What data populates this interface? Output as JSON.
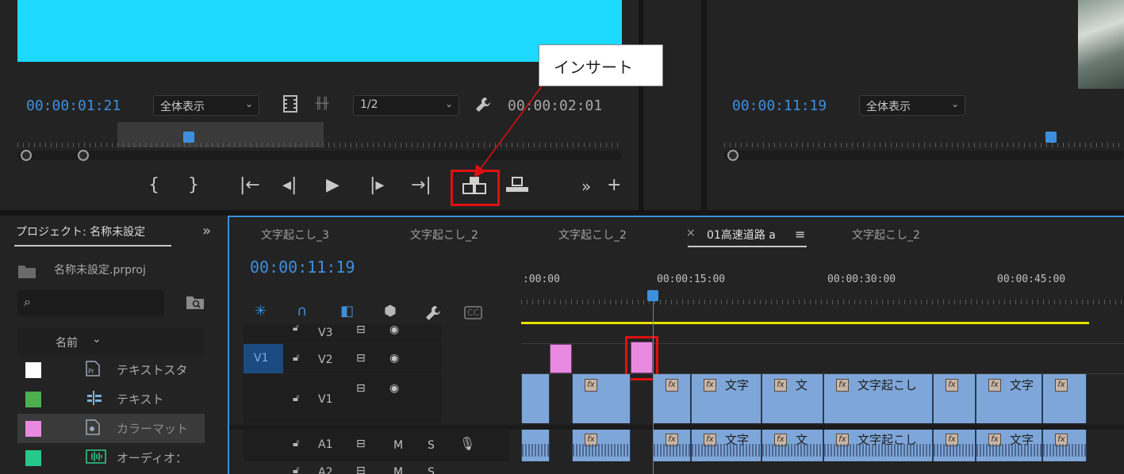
{
  "source_monitor": {
    "current_timecode": "00:00:01:21",
    "zoom_select": "全体表示",
    "resolution_select": "1/2",
    "duration_timecode": "00:00:02:01",
    "frame_color": "#1cd9ff"
  },
  "program_monitor": {
    "current_timecode": "00:00:11:19",
    "zoom_select": "全体表示"
  },
  "callout": {
    "text": "インサート"
  },
  "project_panel": {
    "tab_label": "プロジェクト: 名称未設定",
    "project_file": "名称未設定.prproj",
    "column_header": "名前",
    "items": [
      {
        "label": "テキストスタ",
        "color": "#ffffff",
        "icon": "pr-text-icon"
      },
      {
        "label": "テキスト",
        "color": "#4caf50",
        "icon": "text-layer-icon"
      },
      {
        "label": "カラーマット",
        "color": "#e88ae0",
        "icon": "color-matte-icon"
      },
      {
        "label": "オーディオ：",
        "color": "#26c98a",
        "icon": "audio-waveform-icon"
      }
    ]
  },
  "timeline": {
    "sequence_tabs": [
      "文字起こし_3",
      "文字起こし_2",
      "文字起こし_2",
      "01高速道路 a",
      "文字起こし_2"
    ],
    "active_tab_index": 3,
    "current_timecode": "00:00:11:19",
    "ruler_labels": [
      ":00:00",
      "00:00:15:00",
      "00:00:30:00",
      "00:00:45:00"
    ],
    "tracks": {
      "v3": "V3",
      "v2": "V2",
      "v1": "V1",
      "v1_source": "V1",
      "a1": "A1",
      "a2": "A2",
      "mute": "M",
      "solo": "S"
    },
    "video_clip_names": [
      "文字",
      "文",
      "文字起こし",
      "文字"
    ],
    "audio_clip_names": [
      "文字",
      "文",
      "文字起こし",
      "文字"
    ]
  }
}
